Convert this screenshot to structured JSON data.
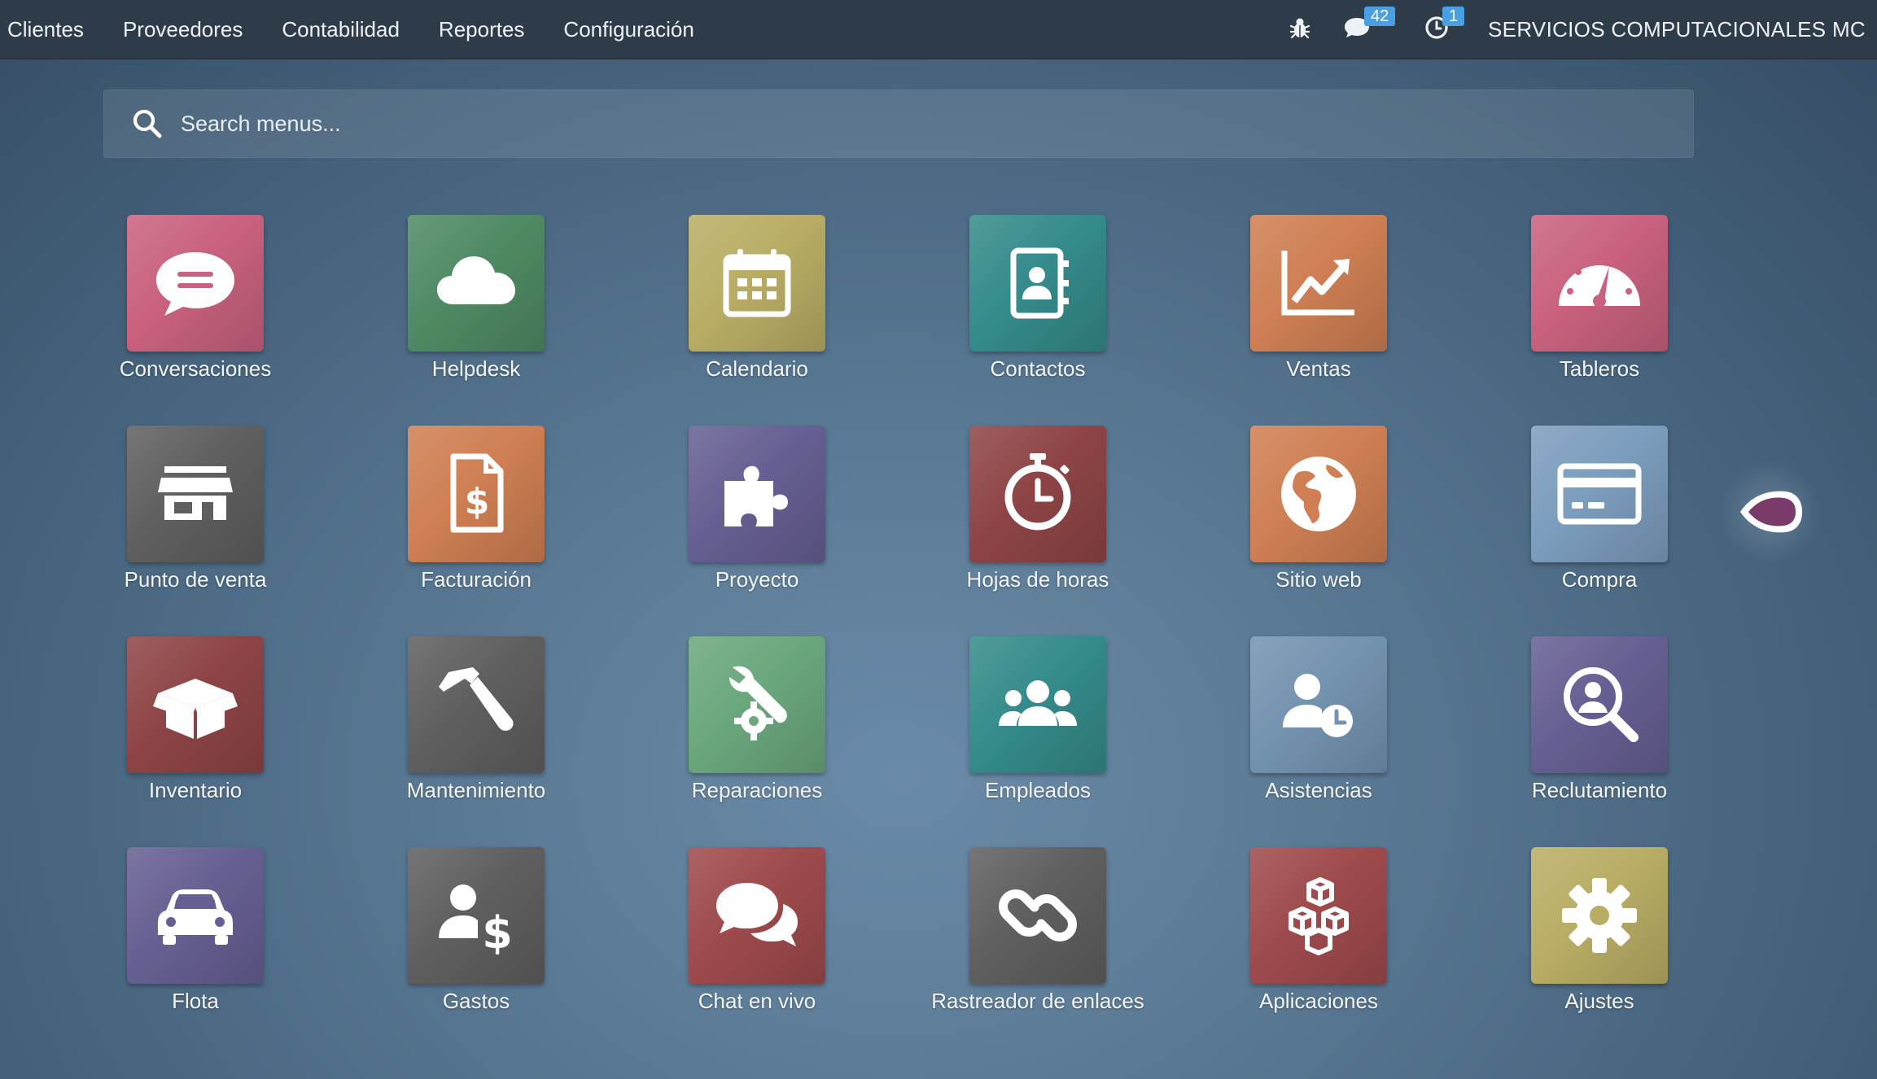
{
  "topbar": {
    "menu": [
      "Clientes",
      "Proveedores",
      "Contabilidad",
      "Reportes",
      "Configuración"
    ],
    "debug_icon": "bug-icon",
    "messages_icon": "chat-icon",
    "messages_count": "42",
    "activities_icon": "clock-icon",
    "activities_count": "1",
    "company": "SERVICIOS COMPUTACIONALES MC"
  },
  "search": {
    "placeholder": "Search menus...",
    "icon": "search-icon"
  },
  "apps": [
    {
      "label": "Conversaciones",
      "icon": "chat-bubble-icon",
      "color": "#c9617f"
    },
    {
      "label": "Helpdesk",
      "icon": "cloud-icon",
      "color": "#4f8a64"
    },
    {
      "label": "Calendario",
      "icon": "calendar-icon",
      "color": "#b9ad65"
    },
    {
      "label": "Contactos",
      "icon": "address-book-icon",
      "color": "#358b8b"
    },
    {
      "label": "Ventas",
      "icon": "chart-line-icon",
      "color": "#cf7f53"
    },
    {
      "label": "Tableros",
      "icon": "gauge-icon",
      "color": "#c9617f"
    },
    {
      "label": "Punto de venta",
      "icon": "store-icon",
      "color": "#5f5f5f"
    },
    {
      "label": "Facturación",
      "icon": "invoice-dollar-icon",
      "color": "#cf7f53"
    },
    {
      "label": "Proyecto",
      "icon": "puzzle-icon",
      "color": "#665f93"
    },
    {
      "label": "Hojas de horas",
      "icon": "stopwatch-icon",
      "color": "#8e4446"
    },
    {
      "label": "Sitio web",
      "icon": "globe-icon",
      "color": "#cf7f53"
    },
    {
      "label": "Compra",
      "icon": "credit-card-icon",
      "color": "#7c9dbd"
    },
    {
      "label": "Inventario",
      "icon": "open-box-icon",
      "color": "#8e4446"
    },
    {
      "label": "Mantenimiento",
      "icon": "hammer-icon",
      "color": "#5f5f5f"
    },
    {
      "label": "Reparaciones",
      "icon": "wrench-gear-icon",
      "color": "#6aa77d"
    },
    {
      "label": "Empleados",
      "icon": "users-icon",
      "color": "#358b8b"
    },
    {
      "label": "Asistencias",
      "icon": "user-clock-icon",
      "color": "#7493b0"
    },
    {
      "label": "Reclutamiento",
      "icon": "user-search-icon",
      "color": "#665f93"
    },
    {
      "label": "Flota",
      "icon": "car-icon",
      "color": "#665f93"
    },
    {
      "label": "Gastos",
      "icon": "user-dollar-icon",
      "color": "#5f5f5f"
    },
    {
      "label": "Chat en vivo",
      "icon": "comments-icon",
      "color": "#9e4a4c"
    },
    {
      "label": "Rastreador de enlaces",
      "icon": "link-icon",
      "color": "#5f5f5f"
    },
    {
      "label": "Aplicaciones",
      "icon": "cubes-icon",
      "color": "#9e4a4c"
    },
    {
      "label": "Ajustes",
      "icon": "gear-icon",
      "color": "#b9ad65"
    }
  ],
  "assistant": {
    "icon": "assistant-bubble-icon",
    "color": "#7a3a6a"
  }
}
